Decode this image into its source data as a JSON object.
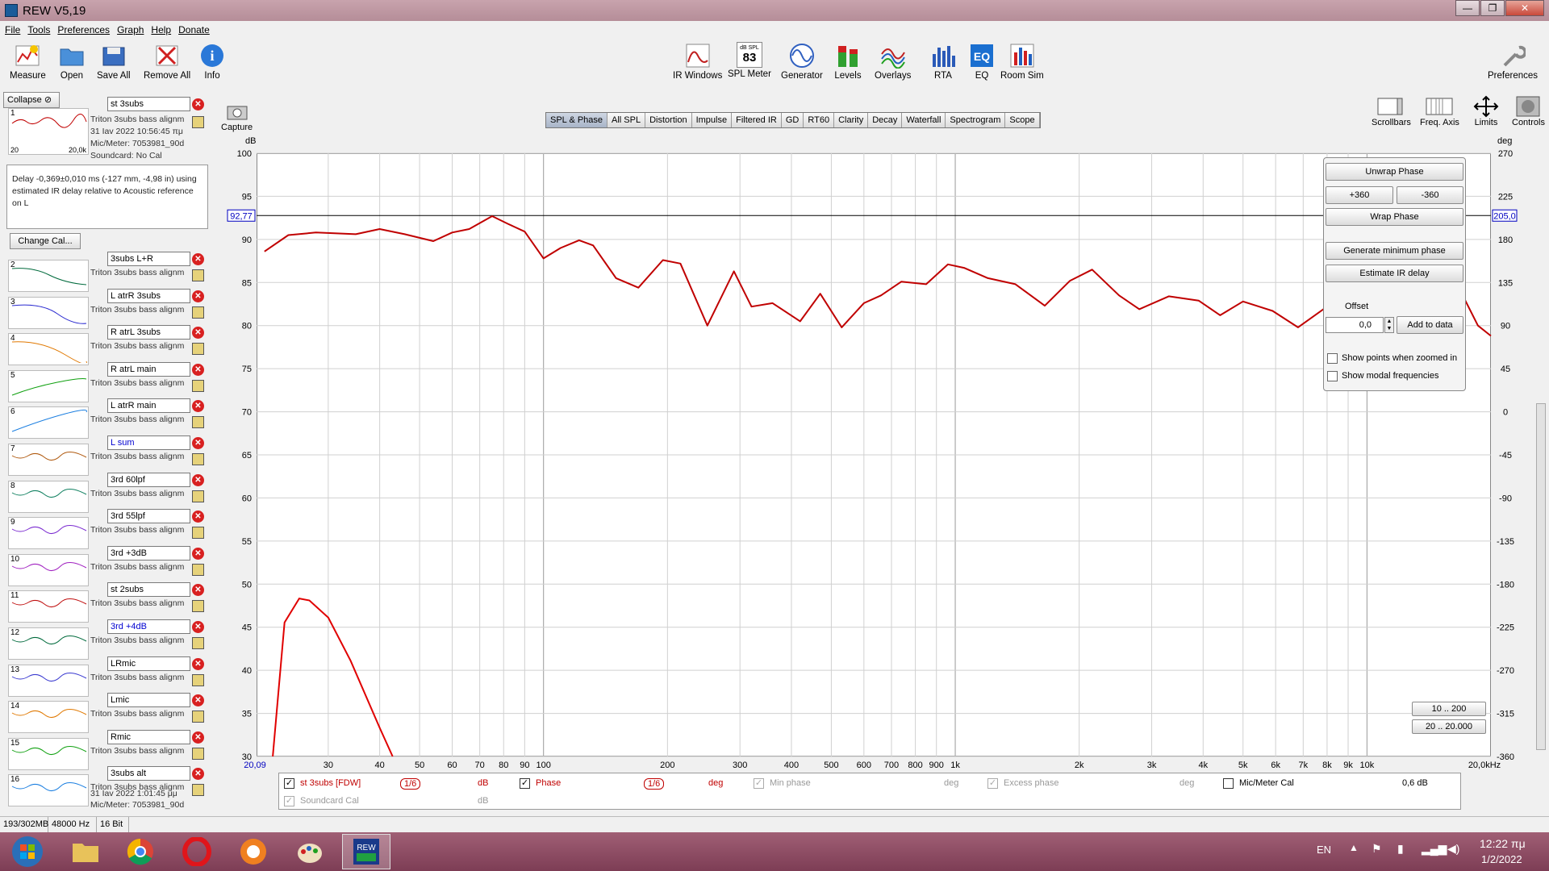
{
  "window": {
    "title": "REW V5,19",
    "min": "—",
    "max": "❐",
    "close": "✕"
  },
  "menu": [
    "File",
    "Tools",
    "Preferences",
    "Graph",
    "Help",
    "Donate"
  ],
  "toolbar": {
    "measure": "Measure",
    "open": "Open",
    "save_all": "Save All",
    "remove_all": "Remove All",
    "info": "Info",
    "ir_windows": "IR Windows",
    "spl_meter": "SPL Meter",
    "spl_value": "83",
    "spl_unit": "dB SPL",
    "generator": "Generator",
    "levels": "Levels",
    "overlays": "Overlays",
    "rta": "RTA",
    "eq": "EQ",
    "room_sim": "Room Sim",
    "preferences": "Preferences",
    "capture": "Capture",
    "scrollbars": "Scrollbars",
    "freq_axis": "Freq. Axis",
    "limits": "Limits",
    "controls": "Controls"
  },
  "tabs": [
    "SPL & Phase",
    "All SPL",
    "Distortion",
    "Impulse",
    "Filtered IR",
    "GD",
    "RT60",
    "Clarity",
    "Decay",
    "Waterfall",
    "Spectrogram",
    "Scope"
  ],
  "left": {
    "collapse": "Collapse",
    "change_cal": "Change Cal...",
    "info_text": "Delay -0,369±0,010 ms (-127 mm, -4,98 in) using estimated IR delay relative to Acoustic reference on  L",
    "first": {
      "name": "st 3subs",
      "line1": "Triton 3subs bass alignm",
      "line2": "31 Iav 2022 10:56:45 πμ",
      "line3": "Mic/Meter: 7053981_90d",
      "line4": "Soundcard: No Cal",
      "axis_lo": "20",
      "axis_hi": "20,0k"
    },
    "measurements": [
      {
        "num": "2",
        "name": "3subs L+R",
        "desc": "Triton 3subs bass alignm",
        "color": "#006a3c"
      },
      {
        "num": "3",
        "name": "L atrR 3subs",
        "desc": "Triton 3subs bass alignm",
        "color": "#2a2ad0"
      },
      {
        "num": "4",
        "name": "R atrL 3subs",
        "desc": "Triton 3subs bass alignm",
        "color": "#e07800"
      },
      {
        "num": "5",
        "name": "R atrL main",
        "desc": "Triton 3subs bass alignm",
        "color": "#10a010"
      },
      {
        "num": "6",
        "name": "L atrR main",
        "desc": "Triton 3subs bass alignm",
        "color": "#1a7ee0"
      },
      {
        "num": "7",
        "name": "L sum",
        "desc": "Triton 3subs bass alignm",
        "color": "#b05a10"
      },
      {
        "num": "8",
        "name": "3rd 60lpf",
        "desc": "Triton 3subs bass alignm",
        "color": "#108060"
      },
      {
        "num": "9",
        "name": "3rd 55lpf",
        "desc": "Triton 3subs bass alignm",
        "color": "#7a2ad0"
      },
      {
        "num": "10",
        "name": "3rd +3dB",
        "desc": "Triton 3subs bass alignm",
        "color": "#a020c0"
      },
      {
        "num": "11",
        "name": "st 2subs",
        "desc": "Triton 3subs bass alignm",
        "color": "#c01010"
      },
      {
        "num": "12",
        "name": "3rd +4dB",
        "desc": "Triton 3subs bass alignm",
        "color": "#006a3c"
      },
      {
        "num": "13",
        "name": "LRmic",
        "desc": "Triton 3subs bass alignm",
        "color": "#3a3ad0"
      },
      {
        "num": "14",
        "name": "Lmic",
        "desc": "Triton 3subs bass alignm",
        "color": "#e07800"
      },
      {
        "num": "15",
        "name": "Rmic",
        "desc": "Triton 3subs bass alignm",
        "color": "#10a010"
      },
      {
        "num": "16",
        "name": "3subs alt",
        "desc": "Triton 3subs bass alignm",
        "color": "#1a7ee0"
      }
    ],
    "last_line2": "31 Iav 2022 1:01:45 μμ",
    "last_line3": "Mic/Meter: 7053981_90d"
  },
  "graph": {
    "y_unit": "dB",
    "y2_unit": "deg",
    "cursor_left": "92,77",
    "cursor_right": "205,0",
    "x_start": "20,09",
    "x_end": "20,0kHz",
    "y_ticks": [
      "100",
      "95",
      "90",
      "85",
      "80",
      "75",
      "70",
      "65",
      "60",
      "55",
      "50",
      "45",
      "40",
      "35",
      "30"
    ],
    "y2_ticks": [
      "270",
      "225",
      "180",
      "135",
      "90",
      "45",
      "0",
      "-45",
      "-90",
      "-135",
      "-180",
      "-225",
      "-270",
      "-315",
      "-360"
    ],
    "x_ticks": [
      "30",
      "40",
      "50",
      "60",
      "70",
      "80",
      "90",
      "100",
      "200",
      "300",
      "400",
      "500",
      "600",
      "700",
      "800",
      "900",
      "1k",
      "2k",
      "3k",
      "4k",
      "5k",
      "6k",
      "7k",
      "8k",
      "9k",
      "10k"
    ],
    "zoom1": "10 .. 200",
    "zoom2": "20 .. 20.000"
  },
  "controls": {
    "unwrap": "Unwrap Phase",
    "plus360": "+360",
    "minus360": "-360",
    "wrap": "Wrap Phase",
    "gen_min": "Generate minimum phase",
    "est_ir": "Estimate IR delay",
    "offset_label": "Offset",
    "offset_value": "0,0",
    "add_to_data": "Add to data",
    "show_points": "Show points when zoomed in",
    "show_modal": "Show modal frequencies"
  },
  "legend": {
    "name": "st 3subs [FDW]",
    "smooth1": "1/6",
    "db": "dB",
    "phase": "Phase",
    "smooth2": "1/6",
    "deg": "deg",
    "min_phase": "Min phase",
    "deg2": "deg",
    "excess": "Excess phase",
    "deg3": "deg",
    "micmeter": "Mic/Meter Cal",
    "cal_val": "0,6 dB",
    "soundcard": "Soundcard Cal",
    "db2": "dB"
  },
  "status": {
    "mem": "193/302MB",
    "rate": "48000 Hz",
    "bits": "16 Bit"
  },
  "taskbar": {
    "lang": "EN",
    "time": "12:22 πμ",
    "date": "1/2/2022"
  },
  "colors": {
    "trace": "#c00000",
    "accent": "#1a5c9a"
  }
}
